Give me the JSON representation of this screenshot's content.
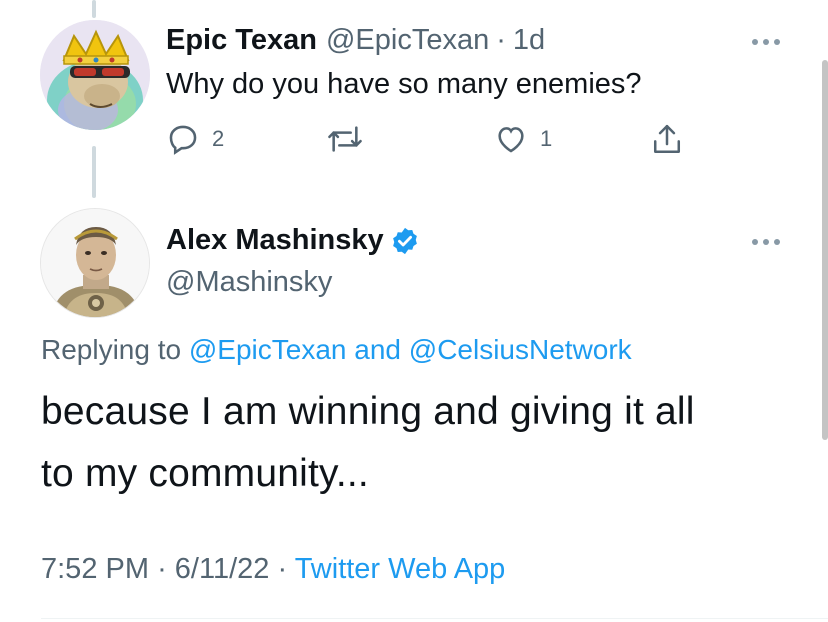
{
  "first_tweet": {
    "display_name": "Epic Texan",
    "handle": "@EpicTexan",
    "separator": "·",
    "age": "1d",
    "text": "Why do you have so many enemies?",
    "reply_count": "2",
    "like_count": "1",
    "icons": [
      "more-icon",
      "reply-icon",
      "retweet-icon",
      "like-icon",
      "share-icon"
    ]
  },
  "main_tweet": {
    "display_name": "Alex Mashinsky",
    "handle": "@Mashinsky",
    "verified": true,
    "replying_prefix": "Replying to",
    "replying_user1": "@EpicTexan",
    "replying_and": "and",
    "replying_user2": "@CelsiusNetwork",
    "text_line1": "because I am winning and giving it all",
    "text_line2": "to my community...",
    "time": "7:52 PM",
    "date": "6/11/22",
    "meta_sep": "·",
    "source": "Twitter Web App"
  },
  "colors": {
    "link": "#1d9bf0",
    "secondary_text": "#536471",
    "primary_text": "#0f1419",
    "verified": "#1d9bf0"
  }
}
